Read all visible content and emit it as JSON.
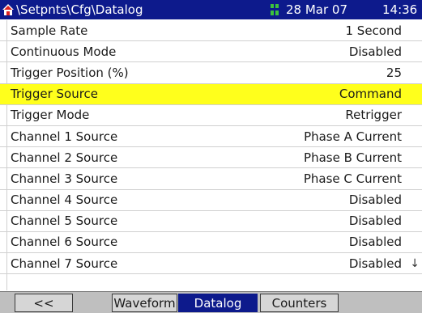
{
  "header": {
    "path": "\\Setpnts\\Cfg\\Datalog",
    "date": "28 Mar 07",
    "time": "14:36",
    "icons": [
      "home-icon",
      "status-icon"
    ]
  },
  "rows": [
    {
      "label": "Sample Rate",
      "value": "1 Second"
    },
    {
      "label": "Continuous Mode",
      "value": "Disabled"
    },
    {
      "label": "Trigger Position (%)",
      "value": "25"
    },
    {
      "label": "Trigger Source",
      "value": "Command"
    },
    {
      "label": "Trigger Mode",
      "value": "Retrigger"
    },
    {
      "label": "Channel 1 Source",
      "value": "Phase A Current"
    },
    {
      "label": "Channel 2 Source",
      "value": "Phase B Current"
    },
    {
      "label": "Channel 3 Source",
      "value": "Phase C Current"
    },
    {
      "label": "Channel 4 Source",
      "value": "Disabled"
    },
    {
      "label": "Channel 5 Source",
      "value": "Disabled"
    },
    {
      "label": "Channel 6 Source",
      "value": "Disabled"
    },
    {
      "label": "Channel 7 Source",
      "value": "Disabled"
    }
  ],
  "selected_row": "Trigger Source",
  "scroll_indicator": "↓",
  "tabs": [
    {
      "label": "<<"
    },
    {
      "label": "Waveform"
    },
    {
      "label": "Datalog"
    },
    {
      "label": "Counters"
    }
  ],
  "active_tab": "Datalog",
  "colors": {
    "header_bg": "#0d1a8c",
    "selected_row_bg": "#ffff1c",
    "tabbar_bg": "#bfbfbf",
    "active_tab_bg": "#0d1a8c"
  }
}
